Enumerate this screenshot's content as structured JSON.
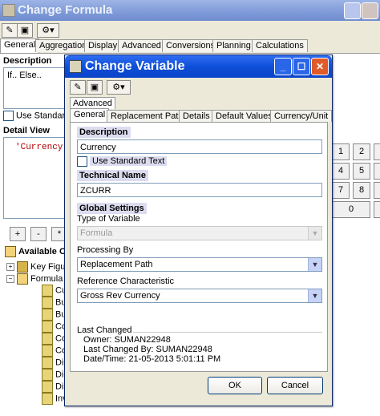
{
  "background_window": {
    "title": "Change Formula",
    "tabs": [
      "General",
      "Aggregation",
      "Display",
      "Advanced",
      "Conversions",
      "Planning",
      "Calculations"
    ],
    "description_heading": "Description",
    "description_value": "If.. Else..",
    "use_standard_text": "Use Standard",
    "detail_view_heading": "Detail View",
    "formula_text": "'Currency",
    "calculator_keys": [
      "1",
      "2",
      "4",
      "5",
      "7",
      "8",
      "0"
    ],
    "operators": [
      "+",
      "-",
      "*"
    ],
    "available_heading": "Available O",
    "tree": {
      "key_figures": "Key Figu",
      "formula_variables": "Formula",
      "leaves": [
        "Cu",
        "Bu",
        "Bu",
        "Co",
        "Co",
        "Co",
        "Di",
        "Di",
        "Di",
        "Inv"
      ]
    }
  },
  "dialog": {
    "title": "Change Variable",
    "advanced_tab": "Advanced",
    "tabs": [
      "General",
      "Replacement Path",
      "Details",
      "Default Values",
      "Currency/Unit"
    ],
    "description": {
      "heading": "Description",
      "value": "Currency",
      "use_standard_text": "Use Standard Text"
    },
    "technical_name": {
      "heading": "Technical Name",
      "value": "ZCURR"
    },
    "global_settings": {
      "heading": "Global Settings",
      "type_label": "Type of Variable",
      "type_value": "Formula",
      "processing_label": "Processing By",
      "processing_value": "Replacement Path",
      "reference_label": "Reference Characteristic",
      "reference_value": "Gross Rev Currency"
    },
    "last_changed": {
      "heading": "Last Changed",
      "owner": "Owner: SUMAN22948",
      "changed_by": "Last Changed By: SUMAN22948",
      "datetime": "Date/Time: 21-05-2013 5:01:11 PM"
    },
    "ok_label": "OK",
    "cancel_label": "Cancel"
  }
}
